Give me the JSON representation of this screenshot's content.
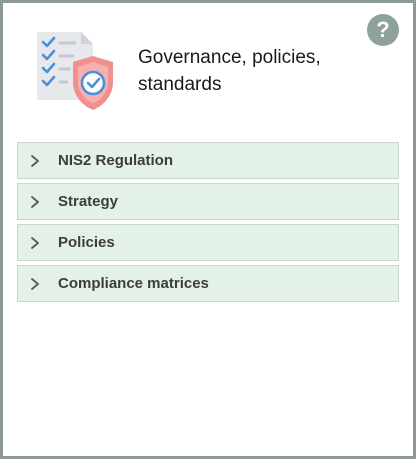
{
  "help": {
    "icon": "question-mark-icon",
    "label": "?",
    "color": "#8fa19c"
  },
  "header": {
    "icon": "checklist-shield-icon",
    "title": "Governance, policies, standards"
  },
  "accordion": {
    "background": "#e3f1e7",
    "items": [
      {
        "label": "NIS2 Regulation",
        "icon": "chevron-right-icon"
      },
      {
        "label": "Strategy",
        "icon": "chevron-right-icon"
      },
      {
        "label": "Policies",
        "icon": "chevron-right-icon"
      },
      {
        "label": "Compliance matrices",
        "icon": "chevron-right-icon"
      }
    ]
  }
}
